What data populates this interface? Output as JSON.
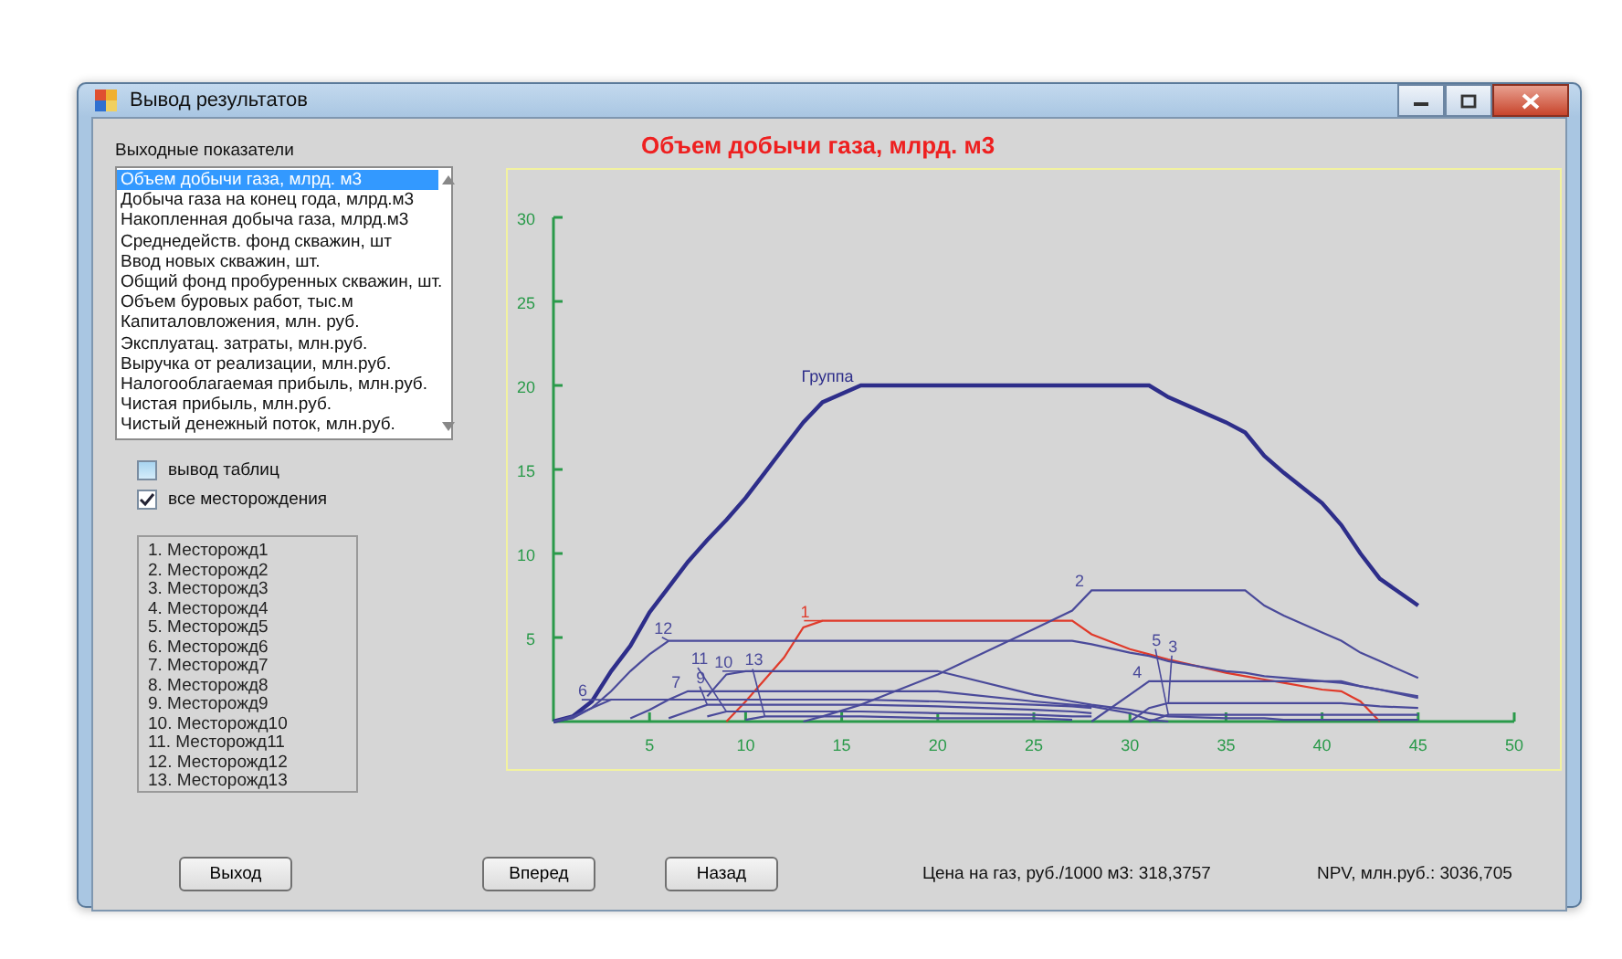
{
  "window": {
    "title": "Вывод результатов"
  },
  "outputs": {
    "label": "Выходные показатели",
    "items": [
      {
        "label": "Объем добычи газа,  млрд. м3",
        "selected": true
      },
      {
        "label": "Добыча газа на конец года, млрд.м3",
        "selected": false
      },
      {
        "label": "Накопленная добыча газа, млрд.м3",
        "selected": false
      },
      {
        "label": "Среднедейств. фонд скважин, шт",
        "selected": false
      },
      {
        "label": "Ввод новых скважин, шт.",
        "selected": false
      },
      {
        "label": "Общий фонд пробуренных скважин, шт.",
        "selected": false
      },
      {
        "label": "Объем буровых работ, тыс.м",
        "selected": false
      },
      {
        "label": "Капиталовложения, млн. руб.",
        "selected": false
      },
      {
        "label": "Эксплуатац. затраты, млн.руб.",
        "selected": false
      },
      {
        "label": "Выручка от реализации, млн.руб.",
        "selected": false
      },
      {
        "label": "Налогооблагаемая прибыль, млн.руб.",
        "selected": false
      },
      {
        "label": "Чистая прибыль, млн.руб.",
        "selected": false
      },
      {
        "label": "Чистый денежный поток, млн.руб.",
        "selected": false
      }
    ]
  },
  "checkboxes": [
    {
      "label": "вывод таблиц",
      "checked": false
    },
    {
      "label": "все месторождения",
      "checked": true
    }
  ],
  "fields": [
    "1. Месторожд1",
    "2. Месторожд2",
    "3. Месторожд3",
    "4. Месторожд4",
    "5. Месторожд5",
    "6. Месторожд6",
    "7. Месторожд7",
    "8. Месторожд8",
    "9. Месторожд9",
    "10. Месторожд10",
    "11. Месторожд11",
    "12. Месторожд12",
    "13. Месторожд13"
  ],
  "chart": {
    "chart_data": {
      "type": "line",
      "title": "Объем добычи газа,  млрд. м3",
      "x": [
        0,
        1,
        2,
        3,
        4,
        5,
        6,
        7,
        8,
        9,
        10,
        11,
        12,
        13,
        14,
        16,
        20,
        25,
        27,
        28,
        30,
        31,
        32,
        35,
        36,
        37,
        38,
        40,
        41,
        42,
        43,
        45
      ],
      "legend": "lower left",
      "xlim": [
        0,
        50
      ],
      "ylim": [
        0,
        30
      ],
      "xticks": [
        5,
        10,
        15,
        20,
        25,
        30,
        35,
        40,
        45,
        50
      ],
      "yticks": [
        5,
        10,
        15,
        20,
        25,
        30
      ],
      "series": [
        {
          "name": "Группа",
          "color": "#2e2e8a",
          "values": [
            0,
            0.3,
            1.2,
            3.0,
            4.5,
            6.5,
            8,
            9.5,
            10.8,
            12,
            13.3,
            14.8,
            16.3,
            17.8,
            19,
            20,
            20,
            20,
            20,
            20,
            20,
            20,
            19.3,
            17.8,
            17.2,
            15.8,
            14.8,
            13,
            11.7,
            10,
            8.5,
            6.9
          ]
        },
        {
          "name": "1",
          "color": "#e03a2a",
          "values": [
            null,
            null,
            null,
            null,
            null,
            null,
            null,
            null,
            null,
            0,
            1.2,
            2.5,
            3.8,
            5.6,
            6,
            6,
            6,
            6,
            6,
            5.2,
            4.3,
            4,
            3.7,
            2.9,
            2.7,
            2.5,
            2.3,
            1.9,
            1.8,
            1.2,
            0,
            null
          ]
        },
        {
          "name": "2",
          "color": "#4a4a9a",
          "values": [
            null,
            null,
            null,
            null,
            null,
            null,
            null,
            null,
            null,
            null,
            null,
            null,
            null,
            0,
            0.3,
            1,
            2.8,
            5.5,
            6.6,
            7.8,
            7.8,
            7.8,
            7.8,
            7.8,
            7.8,
            6.9,
            6.3,
            5.3,
            4.8,
            4.1,
            3.6,
            2.6
          ]
        },
        {
          "name": "12",
          "color": "#4a4a9a",
          "values": [
            0,
            0.2,
            0.8,
            1.8,
            3,
            4,
            4.8,
            4.8,
            4.8,
            4.8,
            4.8,
            4.8,
            4.8,
            4.8,
            4.8,
            4.8,
            4.8,
            4.8,
            4.8,
            4.6,
            4.1,
            3.9,
            3.6,
            3,
            2.9,
            2.7,
            2.6,
            2.4,
            2.3,
            2.1,
            1.9,
            1.5
          ]
        },
        {
          "name": "10",
          "color": "#4a4a9a",
          "values": [
            null,
            null,
            null,
            null,
            null,
            null,
            null,
            null,
            1.5,
            2.8,
            3,
            3,
            3,
            3,
            3,
            3,
            3,
            1.6,
            1.2,
            1,
            0.7,
            0.5,
            0.3,
            0.2,
            0.2,
            0.2,
            0.1,
            0.1,
            0.1,
            0.1,
            0.1,
            0.1
          ]
        },
        {
          "name": "7",
          "color": "#4a4a9a",
          "values": [
            null,
            null,
            null,
            null,
            0.2,
            0.7,
            1.3,
            1.8,
            1.8,
            1.8,
            1.8,
            1.8,
            1.8,
            1.8,
            1.8,
            1.8,
            1.8,
            1.2,
            1,
            0.9,
            0.5,
            0.1,
            0,
            null,
            null,
            null,
            null,
            null,
            null,
            null,
            null,
            null
          ]
        },
        {
          "name": "4",
          "color": "#4a4a9a",
          "values": [
            null,
            null,
            null,
            null,
            null,
            null,
            null,
            null,
            null,
            null,
            null,
            null,
            null,
            null,
            null,
            null,
            null,
            null,
            null,
            0,
            1.6,
            2.4,
            2.4,
            2.4,
            2.4,
            2.4,
            2.4,
            2.4,
            2.4,
            2.1,
            1.9,
            1.4
          ]
        },
        {
          "name": "3",
          "color": "#4a4a9a",
          "values": [
            null,
            null,
            null,
            null,
            null,
            null,
            null,
            null,
            null,
            null,
            null,
            null,
            null,
            null,
            null,
            null,
            null,
            null,
            null,
            null,
            0,
            0.8,
            1.1,
            1.1,
            1.1,
            1.1,
            1.1,
            1.1,
            1.1,
            1.0,
            0.9,
            0.8
          ]
        },
        {
          "name": "5",
          "color": "#4a4a9a",
          "values": [
            null,
            null,
            null,
            null,
            null,
            null,
            null,
            null,
            null,
            null,
            null,
            null,
            null,
            null,
            null,
            null,
            null,
            null,
            null,
            null,
            null,
            0,
            0.4,
            0.4,
            0.4,
            0.4,
            0.4,
            0.4,
            0.4,
            0.4,
            0.4,
            0.4
          ]
        },
        {
          "name": "6",
          "color": "#4a4a9a",
          "values": [
            0,
            0.3,
            0.8,
            1.3,
            1.3,
            1.3,
            1.3,
            1.3,
            1.3,
            1.3,
            1.3,
            1.3,
            1.3,
            1.3,
            1.3,
            1.3,
            1.2,
            1.0,
            0.9,
            0.8,
            null,
            null,
            null,
            null,
            null,
            null,
            null,
            null,
            null,
            null,
            null,
            null
          ]
        },
        {
          "name": "9",
          "color": "#4a4a9a",
          "values": [
            null,
            null,
            null,
            null,
            null,
            null,
            0.2,
            0.6,
            1.0,
            1.0,
            1.0,
            1.0,
            1.0,
            1.0,
            1.0,
            1.0,
            0.9,
            0.7,
            0.6,
            0.5,
            null,
            null,
            null,
            null,
            null,
            null,
            null,
            null,
            null,
            null,
            null,
            null
          ]
        },
        {
          "name": "11",
          "color": "#4a4a9a",
          "values": [
            null,
            null,
            null,
            null,
            null,
            null,
            null,
            null,
            0.3,
            0.6,
            0.6,
            0.6,
            0.6,
            0.6,
            0.6,
            0.6,
            0.5,
            0.4,
            0.3,
            0.3,
            null,
            null,
            null,
            null,
            null,
            null,
            null,
            null,
            null,
            null,
            null,
            null
          ]
        },
        {
          "name": "13",
          "color": "#4a4a9a",
          "values": [
            null,
            null,
            null,
            null,
            null,
            null,
            null,
            null,
            null,
            null,
            0.1,
            0.3,
            0.3,
            0.3,
            0.3,
            0.3,
            0.2,
            0.2,
            0.1,
            null,
            null,
            null,
            null,
            null,
            null,
            null,
            null,
            null,
            null,
            null,
            null,
            null
          ]
        }
      ]
    }
  },
  "buttons": [
    "Выход",
    "Вперед",
    "Назад"
  ],
  "price": "Цена на газ, руб./1000 м3:  318,3757",
  "npv": "NPV, млн.руб.: 3036,705"
}
